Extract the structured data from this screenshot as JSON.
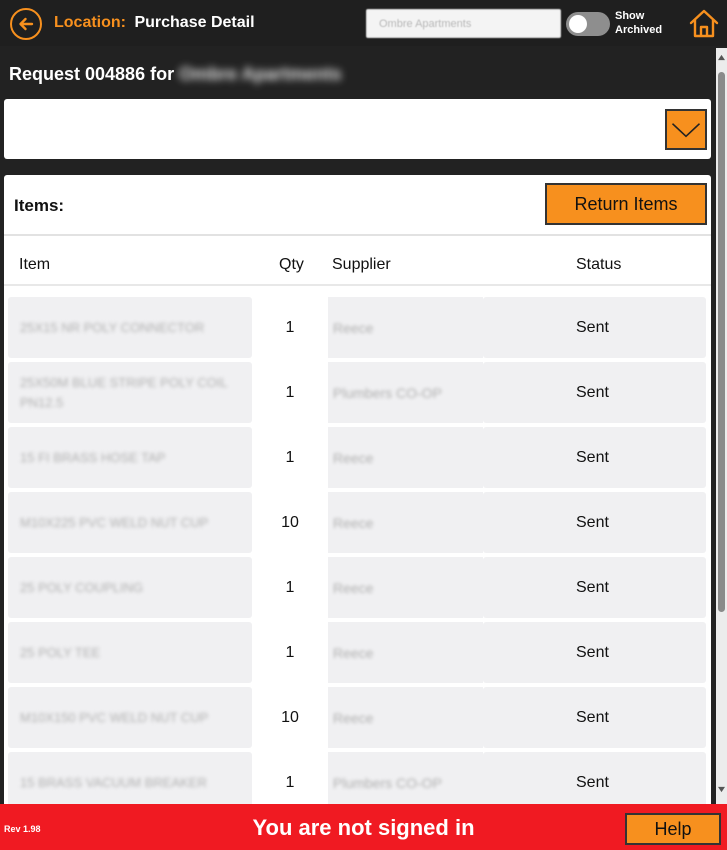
{
  "header": {
    "location_label": "Location:",
    "page_title": "Purchase Detail",
    "location_value": "Ombre Apartments",
    "toggle_label_1": "Show",
    "toggle_label_2": "Archived",
    "toggle_on": false,
    "accent": "#f7901e"
  },
  "request": {
    "title_prefix": "Request 004886 for",
    "property": "Ombre Apartments"
  },
  "items": {
    "label": "Items:",
    "return_button": "Return Items",
    "columns": [
      "Item",
      "Qty",
      "Supplier",
      "Status"
    ],
    "rows": [
      {
        "item": "25X15 NR POLY CONNECTOR",
        "qty": "1",
        "supplier": "Reece",
        "status": "Sent"
      },
      {
        "item": "25X50M BLUE STRIPE POLY COIL PN12.5",
        "qty": "1",
        "supplier": "Plumbers CO-OP",
        "status": "Sent"
      },
      {
        "item": "15 FI BRASS HOSE TAP",
        "qty": "1",
        "supplier": "Reece",
        "status": "Sent"
      },
      {
        "item": "M10X225 PVC WELD NUT CUP",
        "qty": "10",
        "supplier": "Reece",
        "status": "Sent"
      },
      {
        "item": "25 POLY COUPLING",
        "qty": "1",
        "supplier": "Reece",
        "status": "Sent"
      },
      {
        "item": "25 POLY TEE",
        "qty": "1",
        "supplier": "Reece",
        "status": "Sent"
      },
      {
        "item": "M10X150 PVC WELD NUT CUP",
        "qty": "10",
        "supplier": "Reece",
        "status": "Sent"
      },
      {
        "item": "15 BRASS VACUUM BREAKER",
        "qty": "1",
        "supplier": "Plumbers CO-OP",
        "status": "Sent"
      }
    ]
  },
  "footer": {
    "rev": "Rev 1.98",
    "signin_message": "You are not signed in",
    "help_button": "Help",
    "color": "#f01a22"
  }
}
